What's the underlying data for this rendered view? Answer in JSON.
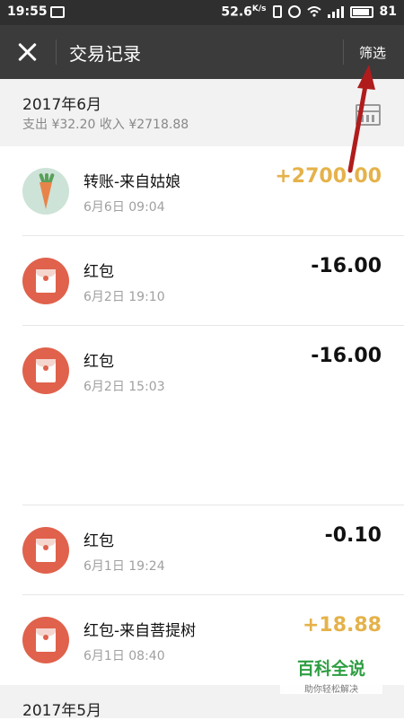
{
  "status_bar": {
    "time": "19:55",
    "speed": "52.6",
    "speed_unit": "K/s",
    "battery": "81"
  },
  "header": {
    "title": "交易记录",
    "filter_label": "筛选"
  },
  "months": [
    {
      "label": "2017年6月",
      "summary": "支出 ¥32.20 收入 ¥2718.88"
    },
    {
      "label": "2017年5月"
    }
  ],
  "transactions": [
    {
      "name": "转账-来自姑娘",
      "date": "6月6日 09:04",
      "amount": "+2700.00",
      "icon": "carrot-avatar"
    },
    {
      "name": "红包",
      "date": "6月2日 19:10",
      "amount": "-16.00",
      "icon": "red-packet-icon"
    },
    {
      "name": "红包",
      "date": "6月2日 15:03",
      "amount": "-16.00",
      "icon": "red-packet-icon"
    },
    {
      "name": "红包",
      "date": "6月1日 19:24",
      "amount": "-0.10",
      "icon": "red-packet-icon"
    },
    {
      "name": "红包-来自菩提树",
      "date": "6月1日 08:40",
      "amount": "+18.88",
      "icon": "red-packet-icon"
    }
  ],
  "watermark": {
    "brand": "百科全说",
    "tagline": "助你轻松解决"
  },
  "colors": {
    "income": "#e5b24a",
    "red_packet": "#e0624c",
    "header_bg": "#3b3b3b",
    "annotation_arrow": "#b01c1c"
  }
}
